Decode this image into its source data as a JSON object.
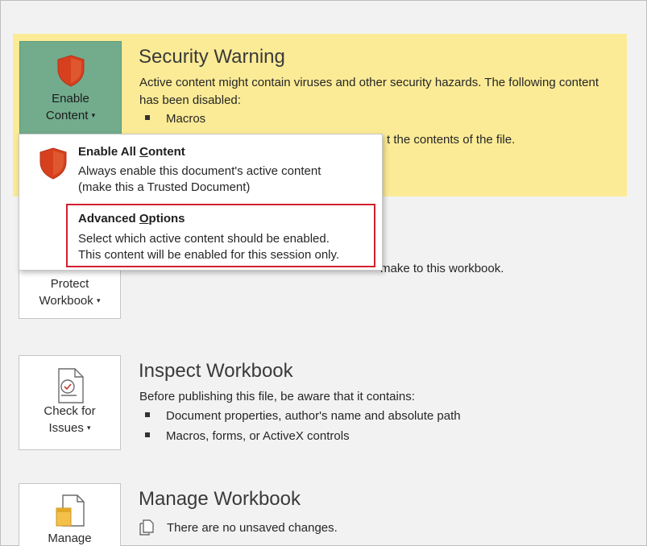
{
  "security": {
    "enable_label_line1": "Enable",
    "enable_label_line2": "Content",
    "title": "Security Warning",
    "text": "Active content might contain viruses and other security hazards. The following content has been disabled:",
    "bullet": "Macros",
    "partial_text": "t the contents of the file."
  },
  "menu": {
    "item1": {
      "title_pre": "Enable All ",
      "title_underline": "C",
      "title_post": "ontent",
      "desc_line1": "Always enable this document's active content",
      "desc_line2": "(make this a Trusted Document)"
    },
    "item2": {
      "title_pre": "Advanced ",
      "title_underline": "O",
      "title_post": "ptions",
      "desc_line1": "Select which active content should be enabled.",
      "desc_line2": "This content will be enabled for this session only."
    }
  },
  "protect": {
    "label_line1": "Protect",
    "label_line2": "Workbook",
    "desc_partial": "make to this workbook."
  },
  "inspect": {
    "tile_line1": "Check for",
    "tile_line2": "Issues",
    "title": "Inspect Workbook",
    "intro": "Before publishing this file, be aware that it contains:",
    "bullets": [
      "Document properties, author's name and absolute path",
      "Macros, forms, or ActiveX controls"
    ]
  },
  "manage": {
    "tile_line1": "Manage",
    "title": "Manage Workbook",
    "status": "There are no unsaved changes."
  },
  "colors": {
    "warning_band": "#fbeb96",
    "enable_button": "#72ac8d",
    "shield": "#d6401e",
    "highlight": "#d2202e"
  }
}
